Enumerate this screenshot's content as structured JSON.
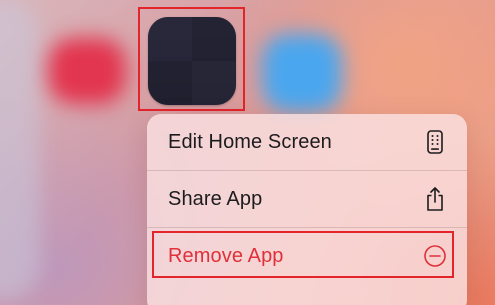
{
  "context_menu": {
    "items": [
      {
        "label": "Edit Home Screen",
        "icon": "phone-icon",
        "destructive": false
      },
      {
        "label": "Share App",
        "icon": "share-icon",
        "destructive": false
      },
      {
        "label": "Remove App",
        "icon": "minus-circle-icon",
        "destructive": true
      }
    ]
  },
  "colors": {
    "destructive": "#e0303a",
    "highlight_border": "#e3242b",
    "menu_background": "#fae0e2",
    "app_icon": "#252536"
  }
}
